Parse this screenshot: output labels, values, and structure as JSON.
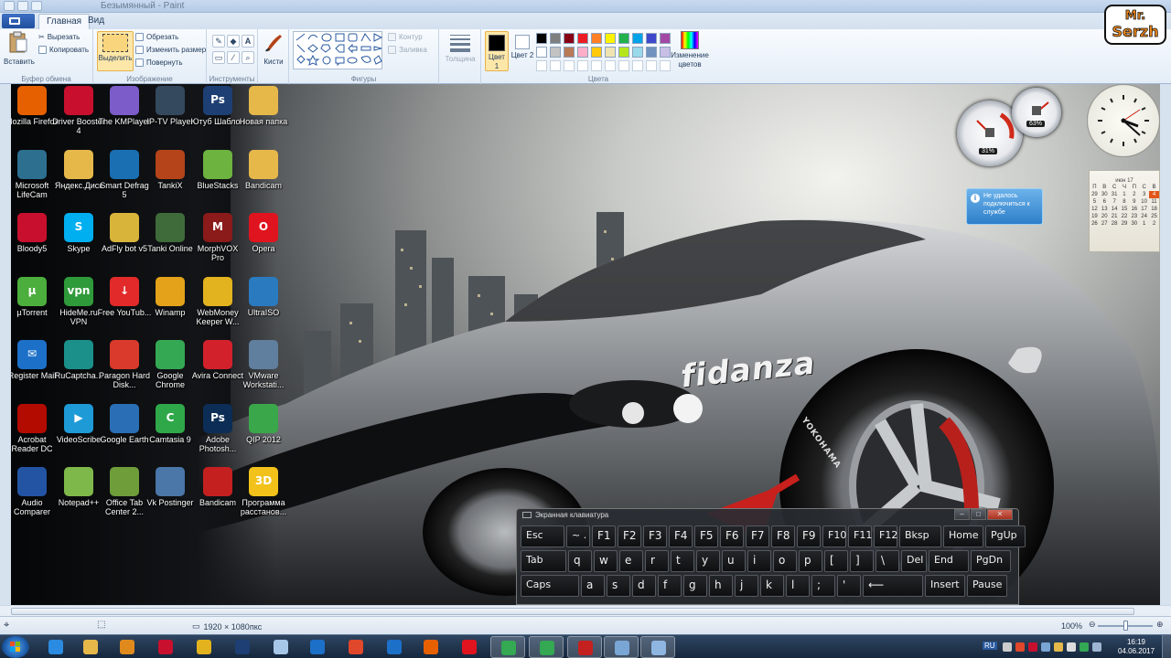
{
  "window": {
    "title": "Безымянный - Paint"
  },
  "tabs": [
    {
      "label": "Главная"
    },
    {
      "label": "Вид"
    }
  ],
  "ribbon": {
    "clipboard": {
      "label": "Буфер обмена",
      "paste": "Вставить",
      "cut": "Вырезать",
      "copy": "Копировать"
    },
    "image": {
      "label": "Изображение",
      "select": "Выделить",
      "crop": "Обрезать",
      "resize": "Изменить размер",
      "rotate": "Повернуть"
    },
    "tools": {
      "label": "Инструменты"
    },
    "brushes": {
      "label": "Кисти"
    },
    "shapes": {
      "label": "Фигуры",
      "outline": "Контур",
      "fill": "Заливка"
    },
    "size": {
      "label": "Толщина"
    },
    "colors": {
      "label": "Цвета",
      "color1": "Цвет 1",
      "color2": "Цвет 2",
      "edit": "Изменение цветов",
      "color1_value": "#000000",
      "color2_value": "#ffffff",
      "palette_row1": [
        "#000000",
        "#7f7f7f",
        "#880015",
        "#ed1c24",
        "#ff7f27",
        "#fff200",
        "#22b14c",
        "#00a2e8",
        "#3f48cc",
        "#a349a4"
      ],
      "palette_row2": [
        "#ffffff",
        "#c3c3c3",
        "#b97a57",
        "#ffaec9",
        "#ffc90e",
        "#efe4b0",
        "#b5e61d",
        "#99d9ea",
        "#7092be",
        "#c8bfe7"
      ]
    }
  },
  "logo": {
    "text": "Mr. Serzh"
  },
  "desktop": {
    "brand_text": "fidanza",
    "tire_text": "YOKOHAMA",
    "icons": [
      {
        "label": "Mozilla Firefox",
        "color": "#e66000",
        "glyph": ""
      },
      {
        "label": "Driver Booster 4",
        "color": "#c8102e",
        "glyph": ""
      },
      {
        "label": "The KMPlayer",
        "color": "#7b5cc9",
        "glyph": ""
      },
      {
        "label": "IP-TV Player",
        "color": "#35495e",
        "glyph": ""
      },
      {
        "label": "Ютуб Шаблон",
        "color": "#1d3f73",
        "glyph": "Ps"
      },
      {
        "label": "Новая папка",
        "color": "#e6b84a",
        "glyph": ""
      },
      {
        "label": "Microsoft LifeCam",
        "color": "#2d6f8f",
        "glyph": ""
      },
      {
        "label": "Яндекс.Диск",
        "color": "#e6b84a",
        "glyph": ""
      },
      {
        "label": "Smart Defrag 5",
        "color": "#1a6fb3",
        "glyph": ""
      },
      {
        "label": "TankiX",
        "color": "#b5441a",
        "glyph": ""
      },
      {
        "label": "BlueStacks",
        "color": "#6cb33f",
        "glyph": ""
      },
      {
        "label": "Bandicam",
        "color": "#e6b84a",
        "glyph": ""
      },
      {
        "label": "Bloody5",
        "color": "#c8102e",
        "glyph": ""
      },
      {
        "label": "Skype",
        "color": "#00aff0",
        "glyph": "S"
      },
      {
        "label": "AdFly bot v5",
        "color": "#d8b43a",
        "glyph": ""
      },
      {
        "label": "Tanki Online",
        "color": "#3f6b3a",
        "glyph": ""
      },
      {
        "label": "MorphVOX Pro",
        "color": "#8b1a1a",
        "glyph": "M"
      },
      {
        "label": "Opera",
        "color": "#e0141e",
        "glyph": "O"
      },
      {
        "label": "µTorrent",
        "color": "#4cae3c",
        "glyph": "µ"
      },
      {
        "label": "HideMe.ru VPN",
        "color": "#2f9a3a",
        "glyph": "vpn"
      },
      {
        "label": "Free YouTub...",
        "color": "#e32a2a",
        "glyph": "↓"
      },
      {
        "label": "Winamp",
        "color": "#e3a21a",
        "glyph": ""
      },
      {
        "label": "WebMoney Keeper W...",
        "color": "#e2b31e",
        "glyph": ""
      },
      {
        "label": "UltraISO",
        "color": "#2a7ac0",
        "glyph": ""
      },
      {
        "label": "Register Mail",
        "color": "#1c70c8",
        "glyph": "✉"
      },
      {
        "label": "RuCaptcha...",
        "color": "#1b8f8a",
        "glyph": ""
      },
      {
        "label": "Paragon Hard Disk...",
        "color": "#d93a2b",
        "glyph": ""
      },
      {
        "label": "Google Chrome",
        "color": "#34a853",
        "glyph": ""
      },
      {
        "label": "Avira Connect",
        "color": "#d3212c",
        "glyph": ""
      },
      {
        "label": "VMware Workstati...",
        "color": "#607f9e",
        "glyph": ""
      },
      {
        "label": "Acrobat Reader DC",
        "color": "#b30b00",
        "glyph": ""
      },
      {
        "label": "VideoScribe",
        "color": "#1e9ad6",
        "glyph": "▶"
      },
      {
        "label": "Google Earth",
        "color": "#2a6fb5",
        "glyph": ""
      },
      {
        "label": "Camtasia 9",
        "color": "#2fa84a",
        "glyph": "C"
      },
      {
        "label": "Adobe Photosh...",
        "color": "#0c2d55",
        "glyph": "Ps"
      },
      {
        "label": "QIP 2012",
        "color": "#3aa84a",
        "glyph": ""
      },
      {
        "label": "Audio Comparer",
        "color": "#2254a3",
        "glyph": ""
      },
      {
        "label": "Notepad++",
        "color": "#7fb84a",
        "glyph": ""
      },
      {
        "label": "Office Tab Center 2...",
        "color": "#6e9d3a",
        "glyph": ""
      },
      {
        "label": "Vk Postinger",
        "color": "#4a76a8",
        "glyph": ""
      },
      {
        "label": "Bandicam",
        "color": "#c42020",
        "glyph": ""
      },
      {
        "label": "Программа расстанов...",
        "color": "#f2c21b",
        "glyph": "3D"
      }
    ]
  },
  "gadgets": {
    "cpu_percent": "31%",
    "ram_percent": "63%",
    "notification": "Не удалось подключиться к службе",
    "calendar": {
      "month": "июн 17",
      "weekdays": [
        "П",
        "В",
        "С",
        "Ч",
        "П",
        "С",
        "В"
      ],
      "weeks": [
        [
          "29",
          "30",
          "31",
          "1",
          "2",
          "3",
          "4"
        ],
        [
          "5",
          "6",
          "7",
          "8",
          "9",
          "10",
          "11"
        ],
        [
          "12",
          "13",
          "14",
          "15",
          "16",
          "17",
          "18"
        ],
        [
          "19",
          "20",
          "21",
          "22",
          "23",
          "24",
          "25"
        ],
        [
          "26",
          "27",
          "28",
          "29",
          "30",
          "1",
          "2"
        ]
      ],
      "today": "4"
    }
  },
  "osk": {
    "title": "Экранная клавиатура",
    "rows": [
      [
        "Esc",
        "~ .",
        "F1",
        "F2",
        "F3",
        "F4",
        "F5",
        "F6",
        "F7",
        "F8",
        "F9",
        "F10",
        "F11",
        "F12",
        "Bksp",
        "Home",
        "PgUp"
      ],
      [
        "Tab",
        "q",
        "w",
        "e",
        "r",
        "t",
        "y",
        "u",
        "i",
        "o",
        "p",
        "[",
        "]",
        "\\",
        "Del",
        "End",
        "PgDn"
      ],
      [
        "Caps",
        "a",
        "s",
        "d",
        "f",
        "g",
        "h",
        "j",
        "k",
        "l",
        ";",
        "'",
        "⟵",
        "Insert",
        "Pause"
      ]
    ]
  },
  "status": {
    "dimensions": "1920 × 1080пкс",
    "zoom": "100%"
  },
  "taskbar": {
    "apps": [
      {
        "name": "ie",
        "color": "#2a8be0"
      },
      {
        "name": "explorer",
        "color": "#e6b84a"
      },
      {
        "name": "media",
        "color": "#e08a1e"
      },
      {
        "name": "driver-booster",
        "color": "#c8102e"
      },
      {
        "name": "webmoney",
        "color": "#e2b31e"
      },
      {
        "name": "photoshop",
        "color": "#1d3f73"
      },
      {
        "name": "notepad",
        "color": "#a7c7e8"
      },
      {
        "name": "teamviewer",
        "color": "#1c70c8"
      },
      {
        "name": "sketch",
        "color": "#e0472b"
      },
      {
        "name": "mail",
        "color": "#1c70c8"
      },
      {
        "name": "firefox",
        "color": "#e66000"
      },
      {
        "name": "opera",
        "color": "#e0141e"
      },
      {
        "name": "chrome",
        "color": "#34a853"
      },
      {
        "name": "chrome-2",
        "color": "#34a853"
      },
      {
        "name": "bandicam",
        "color": "#c42020"
      },
      {
        "name": "computer",
        "color": "#7aa6d6"
      },
      {
        "name": "paint",
        "color": "#8fb6e0"
      }
    ],
    "time": "16:19",
    "date": "04.06.2017",
    "lang": "RU"
  }
}
